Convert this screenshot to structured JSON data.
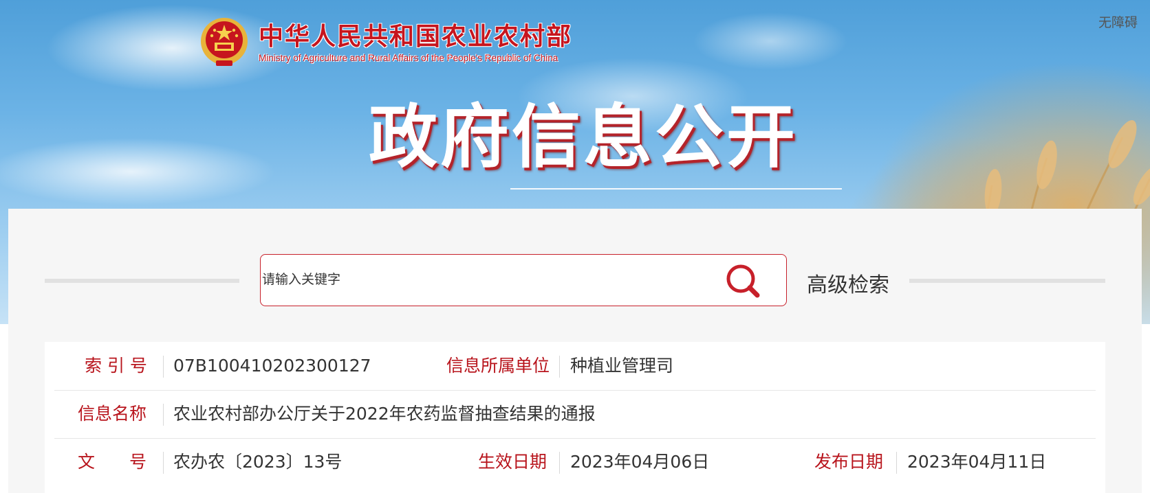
{
  "header": {
    "accessibility_label": "无障碍",
    "ministry_name_cn": "中华人民共和国农业农村部",
    "ministry_name_en": "Ministry of Agriculture and Rural Affairs of the People's Republic of China",
    "banner_title": "政府信息公开"
  },
  "search": {
    "placeholder": "请输入关键字",
    "advanced_label": "高级检索"
  },
  "info": {
    "index_label": "索 引 号",
    "index_value": "07B100410202300127",
    "unit_label": "信息所属单位",
    "unit_value": "种植业管理司",
    "name_label": "信息名称",
    "name_value": "农业农村部办公厅关于2022年农药监督抽查结果的通报",
    "doc_label": "文　　号",
    "doc_value": "农办农〔2023〕13号",
    "effective_label": "生效日期",
    "effective_value": "2023年04月06日",
    "publish_label": "发布日期",
    "publish_value": "2023年04月11日"
  },
  "colors": {
    "brand_red": "#c6151e",
    "label_red": "#b8141c",
    "panel_bg": "#f6f6f6"
  }
}
